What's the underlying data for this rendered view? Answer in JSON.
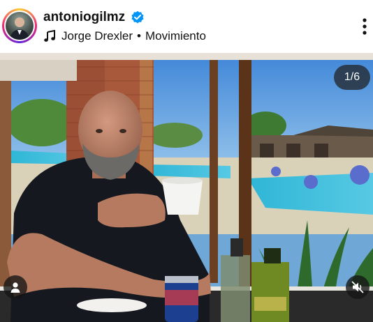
{
  "post": {
    "username": "antoniogilmz",
    "verified": true,
    "music": {
      "artist": "Jorge Drexler",
      "separator": "•",
      "song": "Movimiento"
    },
    "carousel_counter": "1/6"
  },
  "icons": {
    "verified": "verified-badge-icon",
    "music": "music-note-icon",
    "more": "more-vertical-icon",
    "tag": "user-tag-icon",
    "mute": "muted-speaker-icon"
  },
  "colors": {
    "verified_blue": "#0095f6",
    "overlay": "#1e1e1e"
  }
}
